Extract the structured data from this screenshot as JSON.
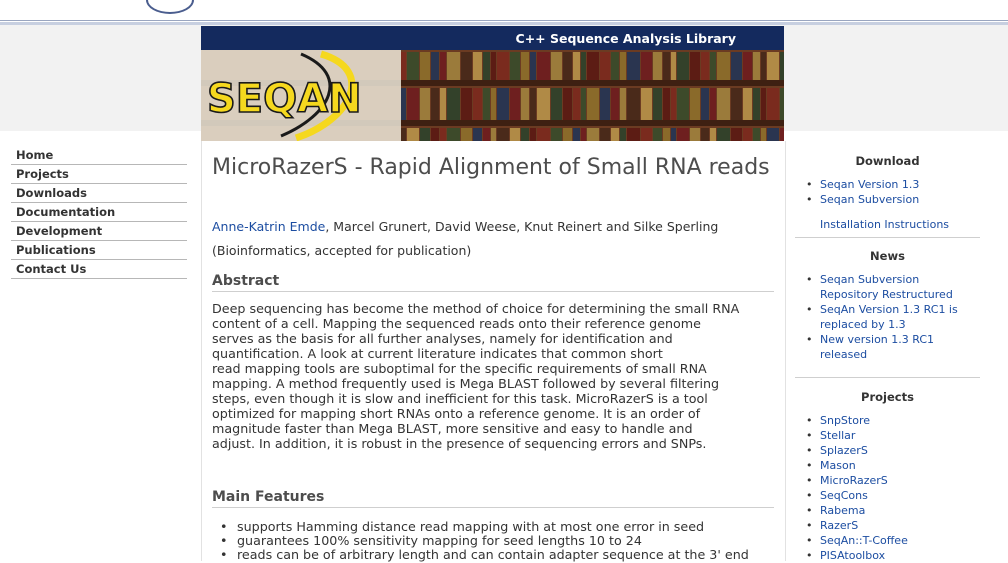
{
  "banner": {
    "tagline": "C++ Sequence Analysis Library",
    "logo": "SEQAN",
    "colors": {
      "bar": "#142a5e",
      "logo_yellow": "#f5d81e"
    }
  },
  "nav": {
    "items": [
      "Home",
      "Projects",
      "Downloads",
      "Documentation",
      "Development",
      "Publications",
      "Contact Us"
    ]
  },
  "article": {
    "title": "MicroRazerS - Rapid Alignment of Small RNA reads",
    "first_author": "Anne-Katrin Emde",
    "other_authors": ", Marcel Grunert, David Weese, Knut Reinert and Silke Sperling",
    "venue": "(Bioinformatics, accepted for publication)",
    "abstract_heading": "Abstract",
    "abstract_lines": [
      "Deep sequencing has become the method of choice for determining the small RNA",
      "content of a cell. Mapping the sequenced reads onto their reference genome",
      "serves as the basis for all further analyses, namely for identification and",
      "quantification. A look at current literature indicates that common short",
      "read mapping tools are suboptimal for the specific requirements of small RNA",
      "mapping. A method frequently used is Mega BLAST followed by several filtering",
      "steps, even though it is slow and inefficient for this task. MicroRazerS is a tool",
      "optimized for mapping short RNAs onto a reference genome. It is an order of",
      "magnitude faster than Mega BLAST, more sensitive and easy to handle and",
      "adjust. In addition, it is robust in the presence of sequencing errors and SNPs."
    ],
    "features_heading": "Main Features",
    "features": [
      "supports Hamming distance read mapping with at most one error in seed",
      "guarantees 100% sensitivity mapping for seed lengths 10 to 24",
      "reads can be of arbitrary length and can contain adapter sequence at the 3' end"
    ]
  },
  "sidebar": {
    "download": {
      "heading": "Download",
      "items": [
        "Seqan Version 1.3",
        "Seqan Subversion"
      ],
      "install": "Installation Instructions"
    },
    "news": {
      "heading": "News",
      "items": [
        [
          "Seqan Subversion",
          "Repository Restructured"
        ],
        [
          "SeqAn Version 1.3 RC1 is",
          "replaced by 1.3"
        ],
        [
          "New version 1.3 RC1",
          "released"
        ]
      ]
    },
    "projects": {
      "heading": "Projects",
      "items": [
        "SnpStore",
        "Stellar",
        "SplazerS",
        "Mason",
        "MicroRazerS",
        "SeqCons",
        "Rabema",
        "RazerS",
        "SeqAn::T-Coffee",
        "PISAtoolbox"
      ]
    }
  }
}
